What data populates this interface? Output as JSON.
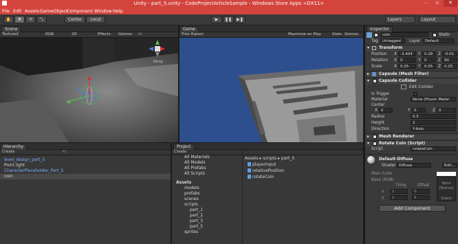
{
  "window": {
    "title": "Unity - part_5.unity - CodeProjectArticleSample - Windows Store Apps <DX11>",
    "controls": [
      "–",
      "▫",
      "✕"
    ]
  },
  "menu": [
    "File",
    "Edit",
    "Assets",
    "GameObject",
    "Component",
    "Window",
    "Help"
  ],
  "toolbar": {
    "tools": [
      "✋",
      "✥",
      "⟲",
      "⤡"
    ],
    "pivot": "Center",
    "space": "Local",
    "play": "▶",
    "pause": "❚❚",
    "step": "▶❚",
    "layers": "Layers",
    "layout": "Layout"
  },
  "scene": {
    "tab": "Scene",
    "render_mode": "Textured",
    "color_mode": "RGB",
    "mode_2d": "2D",
    "effects": "Effects",
    "gizmos": "Gizmos",
    "search": "All",
    "persp": "Persp"
  },
  "game": {
    "tab": "Game",
    "aspect": "Free Aspect",
    "maximize": "Maximize on Play",
    "stats": "Stats",
    "gizmos": "Gizmos"
  },
  "hierarchy": {
    "tab": "Hierarchy",
    "create": "Create",
    "search": "All",
    "items": [
      {
        "label": "level_design_part_5",
        "style": "blue"
      },
      {
        "label": "Point light",
        "style": "plain"
      },
      {
        "label": "CharacterPlaceholder_Part_5",
        "style": "blue"
      },
      {
        "label": "coin",
        "style": "selected"
      }
    ]
  },
  "project": {
    "tab": "Project",
    "create": "Create",
    "favorites": [
      "All Materials",
      "All Models",
      "All Prefabs",
      "All Scripts"
    ],
    "tree_root": "Assets",
    "tree": [
      "models",
      "prefabs",
      "scenes",
      "scripts",
      "part_1",
      "part_2",
      "part_3",
      "part_5",
      "sprites"
    ],
    "breadcrumb": "Assets ▸ scripts ▸ part_5",
    "files": [
      "playerInput",
      "relativePosition",
      "rotateCoin"
    ]
  },
  "inspector": {
    "tab": "Inspector",
    "object_name": "coin",
    "static": "Static",
    "tag_label": "Tag",
    "tag": "Untagged",
    "layer_label": "Layer",
    "layer": "Default",
    "transform": {
      "title": "Transform",
      "position_label": "Position",
      "rotation_label": "Rotation",
      "scale_label": "Scale",
      "position": [
        "-3.404",
        "0.28",
        "-0.01"
      ],
      "rotation": [
        "0",
        "0",
        "90"
      ],
      "scale": [
        "0.25",
        "0.05",
        "0.25"
      ]
    },
    "mesh_filter": {
      "title": "Capsule (Mesh Filter)"
    },
    "collider": {
      "title": "Capsule Collider",
      "edit": "Edit Collider",
      "is_trigger_label": "Is Trigger",
      "material_label": "Material",
      "material": "None (Physic Mater",
      "center_label": "Center",
      "center": [
        "0",
        "0",
        "0"
      ],
      "radius_label": "Radius",
      "radius": "0.5",
      "height_label": "Height",
      "height": "2",
      "direction_label": "Direction",
      "direction": "Y-Axis"
    },
    "mesh_renderer": {
      "title": "Mesh Renderer"
    },
    "script_comp": {
      "title": "Rotate Coin (Script)",
      "script_label": "Script",
      "script": "rotateCoin"
    },
    "material": {
      "name": "Default-Diffuse",
      "shader_label": "Shader",
      "shader": "Diffuse",
      "edit": "Edit...",
      "main_color": "Main Color",
      "base": "Base (RGB)",
      "tiling": "Tiling",
      "offset": "Offset",
      "x": "x",
      "y": "y",
      "tx": "1",
      "ty": "1",
      "ox": "0",
      "oy": "0",
      "none": "None",
      "texture": "(Texture)",
      "select": "Select"
    },
    "add_component": "Add Component"
  },
  "colors": {
    "accent": "#d3443d",
    "panel": "#383838",
    "sky": "#2d4f8e",
    "link": "#7fb0ff"
  }
}
